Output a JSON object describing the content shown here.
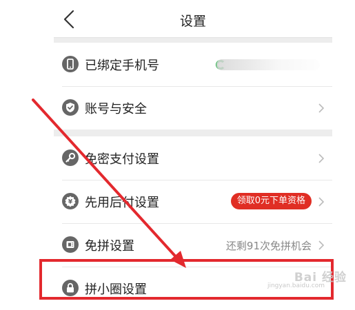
{
  "header": {
    "title": "设置",
    "back_icon": "chevron-left-icon"
  },
  "group1": {
    "items": [
      {
        "label": "已绑定手机号",
        "icon": "phone-icon",
        "value": "(blurred phone number)"
      },
      {
        "label": "账号与安全",
        "icon": "shield-check-icon"
      }
    ]
  },
  "group2": {
    "items": [
      {
        "label": "免密支付设置",
        "icon": "key-icon"
      },
      {
        "label": "先用后付设置",
        "icon": "badge-check-icon",
        "badge": "领取0元下单资格"
      },
      {
        "label": "免拼设置",
        "icon": "coupon-icon",
        "value": "还剩91次免拼机会"
      },
      {
        "label": "拼小圈设置",
        "icon": "lock-icon"
      }
    ]
  },
  "colors": {
    "accent_red": "#e02e24",
    "annotation_red": "#e3292e",
    "background": "#ededed"
  },
  "watermark": {
    "text": "Bai 经验",
    "url": "jingyan.baidu.com"
  }
}
